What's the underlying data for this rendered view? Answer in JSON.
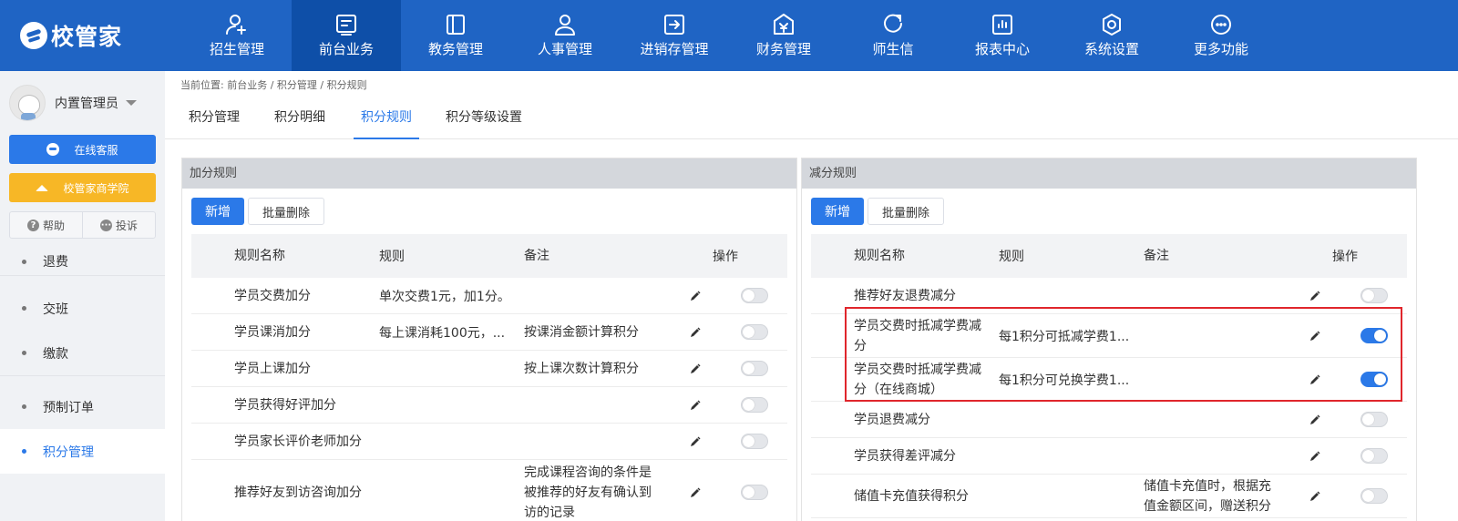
{
  "app": {
    "logo_text": "校管家"
  },
  "nav": [
    {
      "label": "招生管理",
      "icon": "user-add-icon",
      "active": false
    },
    {
      "label": "前台业务",
      "icon": "frontdesk-icon",
      "active": true
    },
    {
      "label": "教务管理",
      "icon": "book-icon",
      "active": false
    },
    {
      "label": "人事管理",
      "icon": "person-icon",
      "active": false
    },
    {
      "label": "进销存管理",
      "icon": "inventory-icon",
      "active": false
    },
    {
      "label": "财务管理",
      "icon": "finance-icon",
      "active": false
    },
    {
      "label": "师生信",
      "icon": "message-icon",
      "active": false
    },
    {
      "label": "报表中心",
      "icon": "report-icon",
      "active": false
    },
    {
      "label": "系统设置",
      "icon": "settings-icon",
      "active": false
    },
    {
      "label": "更多功能",
      "icon": "more-icon",
      "active": false
    }
  ],
  "sidebar": {
    "username": "内置管理员",
    "online_service": "在线客服",
    "academy": "校管家商学院",
    "help": "帮助",
    "complaint": "投诉",
    "items": [
      {
        "label": "退费",
        "active": false
      },
      {
        "label": "交班",
        "active": false
      },
      {
        "label": "缴款",
        "active": false
      },
      {
        "label": "预制订单",
        "active": false
      },
      {
        "label": "积分管理",
        "active": true
      }
    ]
  },
  "breadcrumb": "当前位置: 前台业务 / 积分管理 / 积分规则",
  "tabs": [
    {
      "label": "积分管理",
      "active": false
    },
    {
      "label": "积分明细",
      "active": false
    },
    {
      "label": "积分规则",
      "active": true
    },
    {
      "label": "积分等级设置",
      "active": false
    }
  ],
  "columns": {
    "name": "规则名称",
    "rule": "规则",
    "note": "备注",
    "op": "操作"
  },
  "add_panel": {
    "title": "加分规则",
    "add_btn": "新增",
    "batch_delete_btn": "批量删除",
    "rows": [
      {
        "name": "学员交费加分",
        "rule": "单次交费1元，加1分。",
        "note": "",
        "enabled": false
      },
      {
        "name": "学员课消加分",
        "rule": "每上课消耗100元，...",
        "note": "按课消金额计算积分",
        "enabled": false
      },
      {
        "name": "学员上课加分",
        "rule": "",
        "note": "按上课次数计算积分",
        "enabled": false
      },
      {
        "name": "学员获得好评加分",
        "rule": "",
        "note": "",
        "enabled": false
      },
      {
        "name": "学员家长评价老师加分",
        "rule": "",
        "note": "",
        "enabled": false
      },
      {
        "name": "推荐好友到访咨询加分",
        "rule": "",
        "note": "完成课程咨询的条件是被推荐的好友有确认到访的记录",
        "enabled": false
      }
    ]
  },
  "sub_panel": {
    "title": "减分规则",
    "add_btn": "新增",
    "batch_delete_btn": "批量删除",
    "rows": [
      {
        "name": "推荐好友退费减分",
        "rule": "",
        "note": "",
        "enabled": false
      },
      {
        "name": "学员交费时抵减学费减分",
        "rule": "每1积分可抵减学费1...",
        "note": "",
        "enabled": true
      },
      {
        "name": "学员交费时抵减学费减分（在线商城）",
        "rule": "每1积分可兑换学费1...",
        "note": "",
        "enabled": true
      },
      {
        "name": "学员退费减分",
        "rule": "",
        "note": "",
        "enabled": false
      },
      {
        "name": "学员获得差评减分",
        "rule": "",
        "note": "",
        "enabled": false
      },
      {
        "name": "储值卡充值获得积分",
        "rule": "",
        "note": "储值卡充值时，根据充值金额区间，赠送积分",
        "enabled": false
      }
    ]
  },
  "colors": {
    "primary": "#2b79e8",
    "topbar": "#1f64c4",
    "highlight": "#e0262c"
  }
}
